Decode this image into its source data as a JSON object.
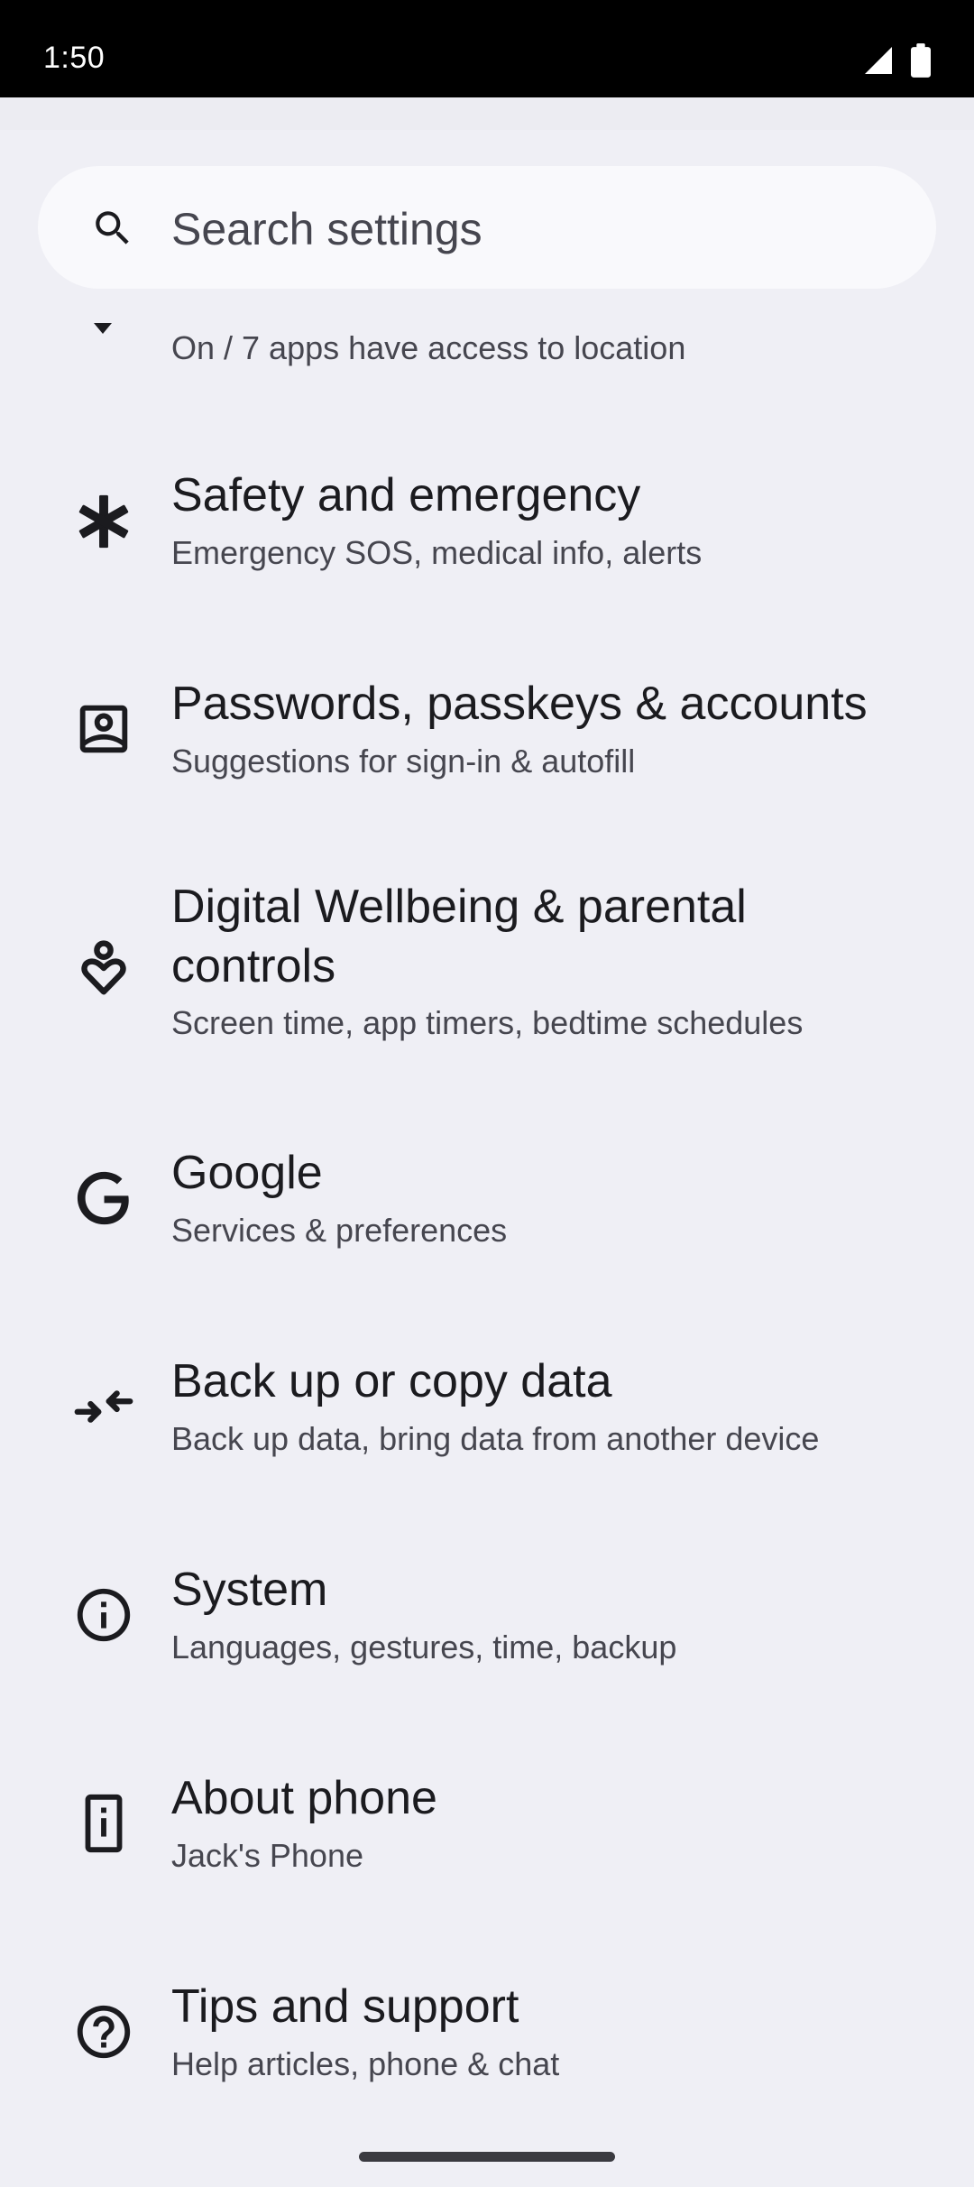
{
  "status_bar": {
    "time": "1:50",
    "icons": [
      "cellular-signal-icon",
      "battery-icon"
    ]
  },
  "search": {
    "placeholder": "Search settings",
    "icon": "search-icon"
  },
  "settings": {
    "partial_item": {
      "subtitle": "On / 7 apps have access to location",
      "icon": "location-icon"
    },
    "items": [
      {
        "title": "Safety and emergency",
        "subtitle": "Emergency SOS, medical info, alerts",
        "icon": "asterisk-icon"
      },
      {
        "title": "Passwords, passkeys & accounts",
        "subtitle": "Suggestions for sign-in & autofill",
        "icon": "account-box-icon"
      },
      {
        "title": "Digital Wellbeing & parental controls",
        "subtitle": "Screen time, app timers, bedtime schedules",
        "icon": "wellbeing-icon"
      },
      {
        "title": "Google",
        "subtitle": "Services & preferences",
        "icon": "google-g-icon"
      },
      {
        "title": "Back up or copy data",
        "subtitle": "Back up data, bring data from another device",
        "icon": "backup-transfer-icon"
      },
      {
        "title": "System",
        "subtitle": "Languages, gestures, time, backup",
        "icon": "info-icon"
      },
      {
        "title": "About phone",
        "subtitle": "Jack's Phone",
        "icon": "phone-info-icon"
      },
      {
        "title": "Tips and support",
        "subtitle": "Help articles, phone & chat",
        "icon": "help-icon"
      }
    ]
  },
  "colors": {
    "background": "#efeff5",
    "status_bar": "#000000",
    "search_bar": "#f9f9fc",
    "title_text": "#1b1b1f",
    "subtitle_text": "#46464f"
  }
}
